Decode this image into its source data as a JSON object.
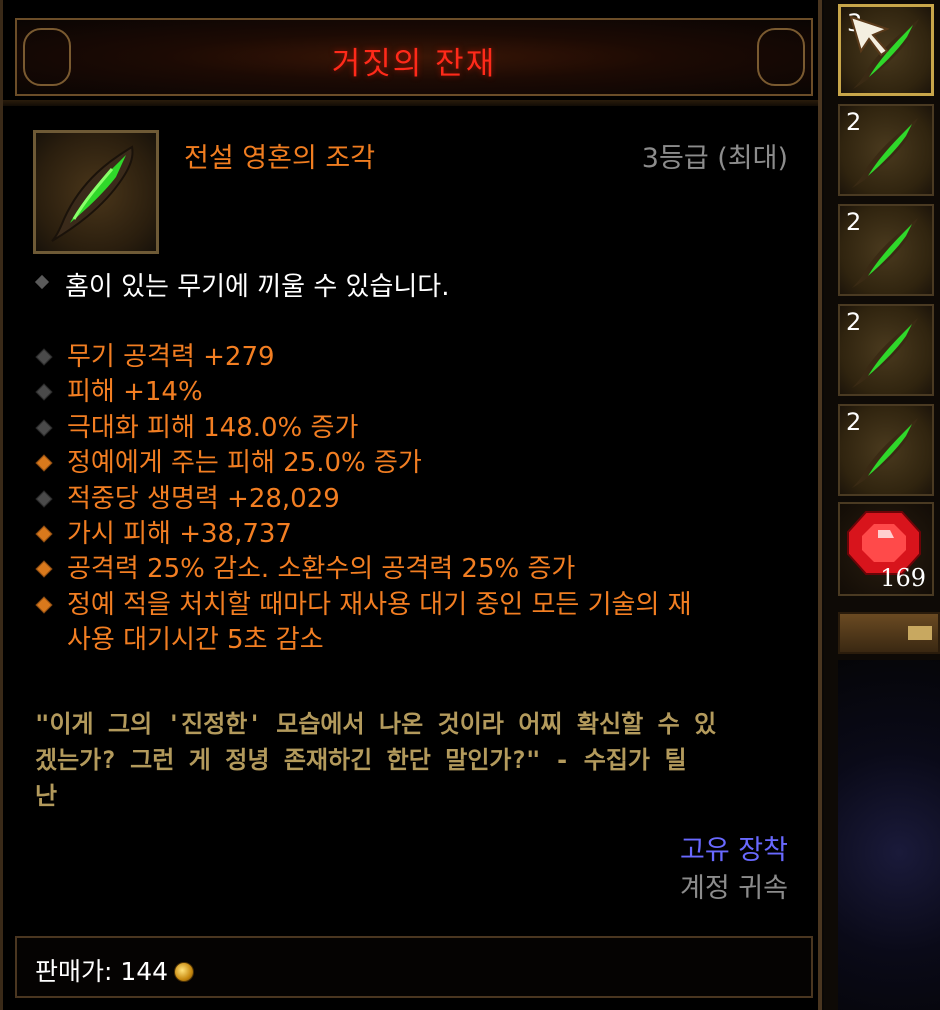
{
  "tooltip": {
    "title": "거짓의 잔재",
    "item_type": "전설 영혼의 조각",
    "rank": "3등급 (최대)",
    "socket_text": "홈이 있는 무기에 끼울 수 있습니다.",
    "affixes": [
      {
        "text": "무기 공격력 +279",
        "bullet": "gray"
      },
      {
        "text": "피해 +14%",
        "bullet": "gray"
      },
      {
        "text": "극대화 피해 148.0% 증가",
        "bullet": "gray"
      },
      {
        "text": "정예에게 주는 피해 25.0% 증가",
        "bullet": "orange"
      },
      {
        "text": "적중당 생명력 +28,029",
        "bullet": "gray"
      },
      {
        "text": "가시 피해 +38,737",
        "bullet": "orange"
      },
      {
        "text": "공격력 25% 감소. 소환수의 공격력 25% 증가",
        "bullet": "orange"
      },
      {
        "text": "정예 적을 처치할 때마다 재사용 대기 중인 모든 기술의 재",
        "bullet": "orange"
      },
      {
        "text": "사용 대기시간 5초 감소",
        "bullet": "none"
      }
    ],
    "flavor_lines": [
      "\"이게 그의 '진정한' 모습에서 나온 것이라 어찌 확신할 수 있",
      "겠는가? 그런 게 정녕 존재하긴 한단 말인가?\" - 수집가 틸",
      "난"
    ],
    "bind_unique": "고유 장착",
    "bind_account": "계정 귀속",
    "sell_label": "판매가: 144",
    "colors": {
      "title": "#ff2a1a",
      "legendary": "#f07d20",
      "rank": "#8c8c8c",
      "flavor": "#b39a5c",
      "unique": "#6969ff"
    }
  },
  "inventory": {
    "slots": [
      {
        "count": "3",
        "selected": true
      },
      {
        "count": "2",
        "selected": false
      },
      {
        "count": "2",
        "selected": false
      },
      {
        "count": "2",
        "selected": false
      },
      {
        "count": "2",
        "selected": false
      }
    ],
    "gem_count": "169"
  }
}
